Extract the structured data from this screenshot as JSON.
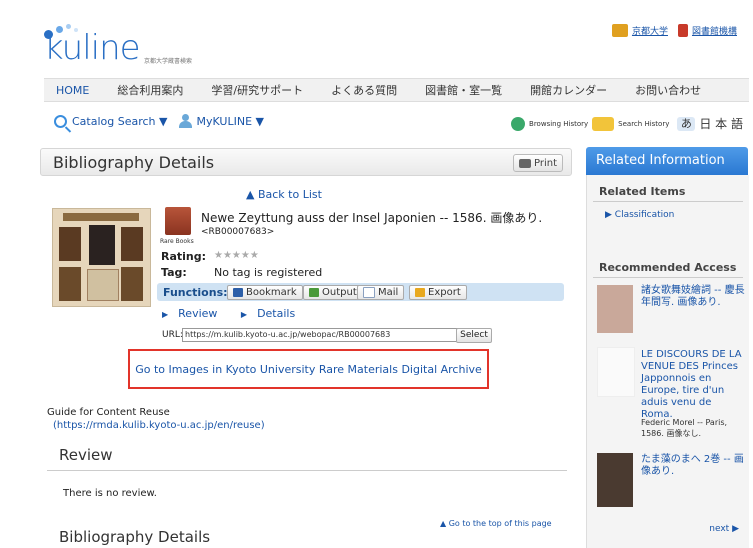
{
  "header": {
    "logo_text": "kuline",
    "logo_subtitle": "京都大学蔵書検索",
    "top_links": [
      {
        "label": "京都大学",
        "color": "#e0a020"
      },
      {
        "label": "図書館機構",
        "color": "#c83a2a"
      }
    ]
  },
  "nav": [
    "HOME",
    "総合利用案内",
    "学習/研究サポート",
    "よくある質問",
    "図書館・室一覧",
    "開館カレンダー",
    "お問い合わせ"
  ],
  "toolbar": {
    "catalog_search": "Catalog Search ▼",
    "mykuline": "MyKULINE ▼",
    "browsing_history": "Browsing History",
    "search_history": "Search History",
    "lang_icon": "あ",
    "lang_label": "日 本 語"
  },
  "main": {
    "title": "Bibliography Details",
    "print_label": "Print",
    "back_link": "▲ Back to List",
    "book_type": "Rare Books",
    "item_title": "Newe Zeyttung auss der Insel Japonien -- 1586. 画像あり.",
    "record_id": "<RB00007683>",
    "rating_label": "Rating:",
    "rating_stars": "★★★★★",
    "rating_value": 0,
    "tag_label": "Tag:",
    "tag_value": "No tag is registered",
    "functions_label": "Functions:",
    "functions": [
      {
        "label": "Bookmark",
        "color": "#2d5fa8"
      },
      {
        "label": "Output",
        "color": "#4a9a3a"
      },
      {
        "label": "Mail",
        "color": "#8aa0c0"
      },
      {
        "label": "Export",
        "color": "#e8a81e"
      }
    ],
    "review_link": "Review",
    "details_link": "Details",
    "url_label": "URL:",
    "url_value": "https://m.kulib.kyoto-u.ac.jp/webopac/RB00007683",
    "select_label": "Select",
    "archive_link": "Go to Images in Kyoto University Rare Materials Digital Archive",
    "guide_title": "Guide for Content Reuse",
    "guide_url": "(https://rmda.kulib.kyoto-u.ac.jp/en/reuse)",
    "review_heading": "Review",
    "no_review": "There is no review.",
    "go_top": "▲ Go to the top of this page",
    "details_heading": "Bibliography Details"
  },
  "related": {
    "header": "Related Information",
    "related_items_heading": "Related Items",
    "classification_link": "▶ Classification",
    "recommended_heading": "Recommended Access",
    "items": [
      {
        "title": "諸女歌舞妓繪詞 -- 慶長年間写. 画像あり.",
        "sub": ""
      },
      {
        "title": "LE DISCOURS DE LA VENUE DES Princes Japponnois en Europe, tire d'un aduis venu de Roma.",
        "sub": "Federic Morel -- Paris, 1586. 画像なし."
      },
      {
        "title": "たま藻のまへ 2巻 -- 画像あり.",
        "sub": ""
      }
    ],
    "next": "next ▶"
  },
  "colors": {
    "accent": "#1a55a8",
    "highlight_box": "#e2342a",
    "panel_header": "#3a88dc"
  }
}
